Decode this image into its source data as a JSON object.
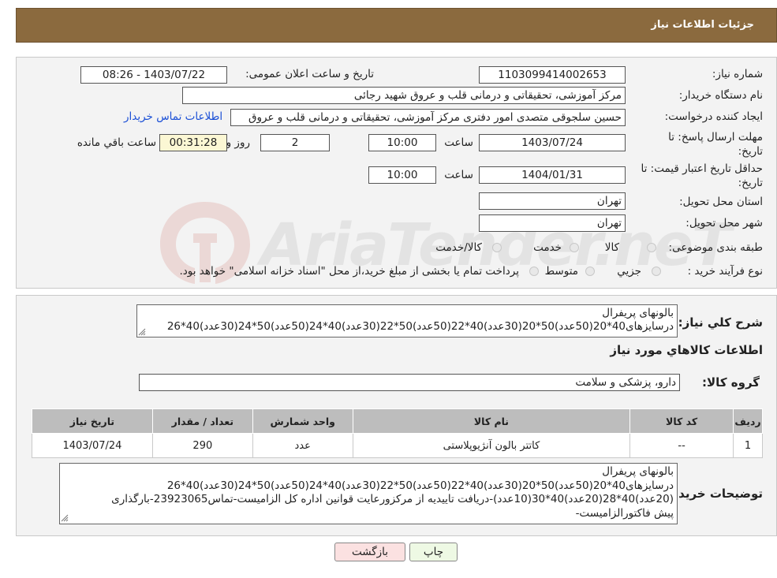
{
  "header": {
    "title": "جزئیات اطلاعات نیاز"
  },
  "form": {
    "need_number_label": "شماره نیاز:",
    "need_number": "1103099414002653",
    "announce_label": "تاریخ و ساعت اعلان عمومی:",
    "announce_value": "1403/07/22 - 08:26",
    "buyer_label": "نام دستگاه خریدار:",
    "buyer_value": "مرکز آموزشی، تحقیقاتی و درمانی قلب و عروق شهید رجائی",
    "creator_label": "ایجاد کننده درخواست:",
    "creator_value": "حسین سلجوقی متصدی امور دفتری مرکز آموزشی، تحقیقاتی و درمانی قلب و عروق",
    "contact_link": "اطلاعات تماس خریدار",
    "deadline_label_1": "مهلت ارسال پاسخ: تا",
    "deadline_label_2": "تاریخ:",
    "deadline_date": "1403/07/24",
    "time_label": "ساعت",
    "deadline_time": "10:00",
    "days_value": "2",
    "days_label": "روز و",
    "remaining_time": "00:31:28",
    "remaining_label": "ساعت باقي مانده",
    "validity_label_1": "حداقل تاریخ اعتبار قیمت: تا",
    "validity_label_2": "تاریخ:",
    "validity_date": "1404/01/31",
    "validity_time": "10:00",
    "province_label": "استان محل تحویل:",
    "province_value": "تهران",
    "city_label": "شهر محل تحویل:",
    "city_value": "تهران",
    "category_label": "طبقه بندی موضوعی:",
    "category_options": [
      "کالا",
      "خدمت",
      "کالا/خدمت"
    ],
    "process_label": "نوع فرآیند خرید :",
    "process_options": [
      "جزیي",
      "متوسط"
    ],
    "process_note": "پرداخت تمام یا بخشی از مبلغ خرید،از محل \"اسناد خزانه اسلامی\" خواهد بود."
  },
  "summary": {
    "label": "شرح کلي نياز:",
    "line1": "بالونهای پریفرال",
    "line2": "درسایزهای40*20(50عدد)50*20(30عدد)40*22(50عدد)50*22(30عدد)40*24(50عدد)50*24(30عدد)40*26"
  },
  "goods_info_title": "اطلاعات کالاهاي مورد نياز",
  "goods_group": {
    "label": "گروه کالا:",
    "value": "دارو، پزشکی و سلامت"
  },
  "table": {
    "headers": [
      "رديف",
      "کد کالا",
      "نام کالا",
      "واحد شمارش",
      "تعداد / مقدار",
      "تاریخ نیاز"
    ],
    "rows": [
      [
        "1",
        "--",
        "کاتتر بالون آنژیوپلاستی",
        "عدد",
        "290",
        "1403/07/24"
      ]
    ]
  },
  "buyer_notes": {
    "label": "توضیحات خریدار:",
    "line1": "بالونهای پریفرال",
    "line2": "درسایزهای40*20(50عدد)50*20(30عدد)40*22(50عدد)50*22(30عدد)40*24(50عدد)50*24(30عدد)40*26",
    "line3": "(20عدد)40*28(20عدد)40*30(10عدد)-دریافت تاییدیه از مرکزورعایت قوانین اداره کل الزامیست-تماس23923065-بارگذاری",
    "line4": "پیش فاکتورالزامیست-"
  },
  "buttons": {
    "print": "چاپ",
    "back": "بازگشت"
  },
  "watermark": {
    "text": "AriaTender.neT"
  }
}
